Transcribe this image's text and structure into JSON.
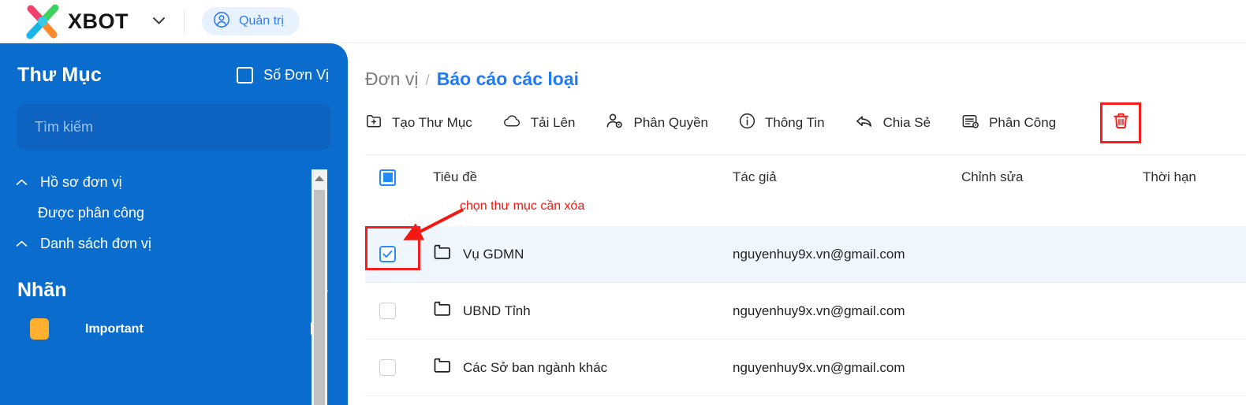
{
  "topbar": {
    "logo_icon": "xbot-x-logo-icon",
    "logo_text": "XBOT",
    "caret_icon": "chevron-down-icon",
    "user_icon": "user-circle-icon",
    "user_label": "Quản trị",
    "logo_colors": {
      "top_left": "#f2426a",
      "top_right": "#3ed35f",
      "bottom_left": "#18b6e8",
      "bottom_right": "#ff8a2b",
      "center": "#39c9e8"
    }
  },
  "sidebar": {
    "title": "Thư Mục",
    "toggle_label": "Số Đơn Vị",
    "toggle_checked": false,
    "search_placeholder": "Tìm kiếm",
    "search_value": "",
    "items": [
      {
        "label": "Hồ sơ đơn vị",
        "has_caret": true,
        "sub": false
      },
      {
        "label": "Được phân công",
        "has_caret": false,
        "sub": true
      },
      {
        "label": "Danh sách đơn vị",
        "has_caret": true,
        "sub": false
      }
    ],
    "tags_title": "Nhãn",
    "add_tag_icon": "plus-icon",
    "tags": [
      {
        "name": "Important",
        "color": "#ffb02e",
        "edit_icon": "edit-square-icon"
      }
    ],
    "scrollbar": {
      "up_icon": "scroll-up-arrow-icon"
    },
    "background_color": "#0a6ccc"
  },
  "main": {
    "breadcrumb": {
      "parent": "Đơn vị",
      "separator": "/",
      "current": "Báo cáo các loại"
    },
    "toolbar": [
      {
        "label": "Tạo Thư Mục",
        "icon": "folder-plus-icon"
      },
      {
        "label": "Tải Lên",
        "icon": "cloud-upload-icon"
      },
      {
        "label": "Phân Quyền",
        "icon": "user-permission-icon"
      },
      {
        "label": "Thông Tin",
        "icon": "info-circle-icon"
      },
      {
        "label": "Chia Sẻ",
        "icon": "share-reply-icon"
      },
      {
        "label": "Phân Công",
        "icon": "assignment-icon"
      }
    ],
    "delete_button": {
      "icon": "trash-icon",
      "highlight_color": "#f71d1d"
    },
    "table": {
      "headers": {
        "select": "select-all-checkbox",
        "title": "Tiêu đề",
        "author": "Tác giả",
        "modified": "Chỉnh sửa",
        "due": "Thời hạn"
      },
      "select_all_state": "indeterminate",
      "rows": [
        {
          "title": "Vụ GDMN",
          "author": "nguyenhuy9x.vn@gmail.com",
          "modified": "",
          "due": "",
          "checked": true,
          "selected": true,
          "icon": "folder-icon"
        },
        {
          "title": "UBND Tỉnh",
          "author": "nguyenhuy9x.vn@gmail.com",
          "modified": "",
          "due": "",
          "checked": false,
          "selected": false,
          "icon": "folder-icon"
        },
        {
          "title": "Các Sở ban ngành khác",
          "author": "nguyenhuy9x.vn@gmail.com",
          "modified": "",
          "due": "",
          "checked": false,
          "selected": false,
          "icon": "folder-icon"
        }
      ]
    },
    "annotation": {
      "text": "chọn thư mục cần xóa",
      "color": "#f4160f",
      "arrow_icon": "red-arrow-icon"
    }
  }
}
